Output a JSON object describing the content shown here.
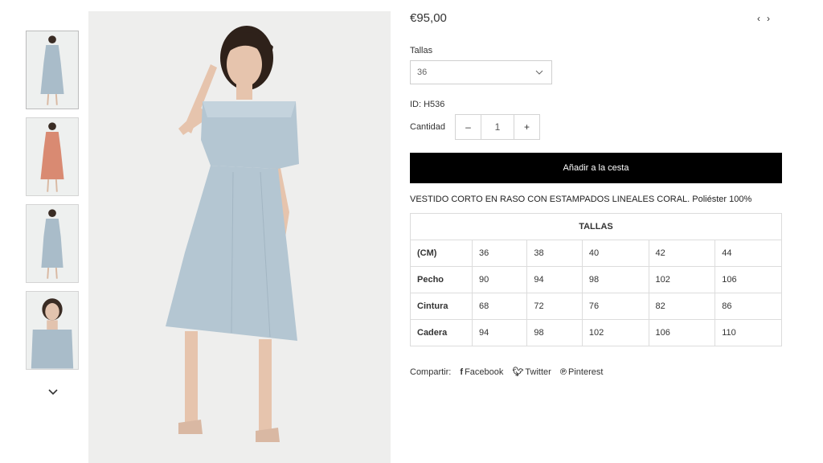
{
  "product": {
    "price": "€95,00",
    "pager": {
      "prev": "‹",
      "next": "›"
    },
    "sizes_label": "Tallas",
    "size_select": {
      "value": "36"
    },
    "id_text": "ID: H536",
    "quantity_label": "Cantidad",
    "quantity": {
      "minus": "–",
      "value": "1",
      "plus": "+"
    },
    "add_to_cart": "Añadir a la cesta",
    "description": "VESTIDO CORTO EN RASO CON ESTAMPADOS LINEALES CORAL. Poliéster 100%"
  },
  "size_table": {
    "title": "TALLAS",
    "header_row": [
      "(CM)",
      "36",
      "38",
      "40",
      "42",
      "44"
    ],
    "rows": [
      [
        "Pecho",
        "90",
        "94",
        "98",
        "102",
        "106"
      ],
      [
        "Cintura",
        "68",
        "72",
        "76",
        "82",
        "86"
      ],
      [
        "Cadera",
        "94",
        "98",
        "102",
        "106",
        "110"
      ]
    ]
  },
  "share": {
    "label": "Compartir:",
    "facebook": {
      "icon": "f",
      "text": "Facebook"
    },
    "twitter": {
      "icon": "🐦",
      "text": "Twitter"
    },
    "pinterest": {
      "icon": "℗",
      "text": "Pinterest"
    }
  },
  "gallery": {
    "thumbnails": [
      {
        "dress_color": "#a9bcc9"
      },
      {
        "dress_color": "#d98a72"
      },
      {
        "dress_color": "#a9bcc9"
      },
      {
        "dress_color": "#a9bcc9"
      }
    ],
    "main_dress_color": "#b4c6d2",
    "down_icon": "chevron-down-icon"
  }
}
